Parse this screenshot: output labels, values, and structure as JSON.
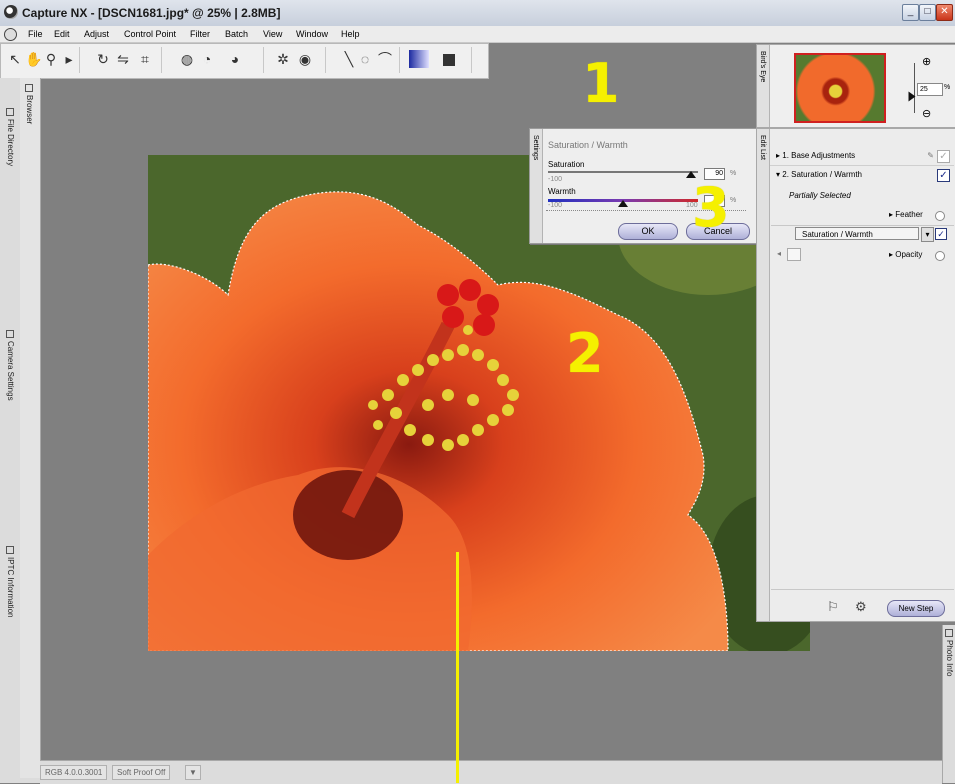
{
  "window": {
    "title": "Capture NX - [DSCN1681.jpg* @ 25% | 2.8MB]",
    "min": "_",
    "max": "□",
    "close": "✕"
  },
  "menu": [
    "File",
    "Edit",
    "Adjust",
    "Control Point",
    "Filter",
    "Batch",
    "View",
    "Window",
    "Help"
  ],
  "left_tabs": {
    "browser": "Browser",
    "file_directory": "File Directory",
    "camera_settings": "Camera Settings",
    "iptc": "IPTC Information"
  },
  "dialog": {
    "side_label": "Settings",
    "title": "Saturation / Warmth",
    "saturation_label": "Saturation",
    "saturation_min": "-100",
    "saturation_value": "90",
    "saturation_unit": "%",
    "saturation_level": 0.95,
    "warmth_label": "Warmth",
    "warmth_min": "-100",
    "warmth_max": "100",
    "warmth_unit": "%",
    "warmth_level": 0.5,
    "ok_label": "OK",
    "cancel_label": "Cancel"
  },
  "birds_eye": {
    "side_label": "Bird's Eye",
    "zoom_value": "25",
    "zoom_unit": "%"
  },
  "edit_list": {
    "side_label": "Edit List",
    "steps": [
      {
        "label": "1. Base Adjustments"
      },
      {
        "label": "2. Saturation / Warmth"
      }
    ],
    "partially_selected": "Partially Selected",
    "feather": "Feather",
    "blend_mode": "Saturation / Warmth",
    "opacity": "Opacity",
    "new_step": "New Step"
  },
  "photo_info": "Photo Info",
  "status": {
    "rgb": "RGB 4.0.0.3001",
    "soft_proof": "Soft Proof Off"
  },
  "annotations": [
    "1",
    "2",
    "3"
  ],
  "colors": {
    "annotation": "#f5f000",
    "petal": "#f0622a",
    "stamen": "#e6d23a",
    "warmth_track": "#c0282a"
  }
}
